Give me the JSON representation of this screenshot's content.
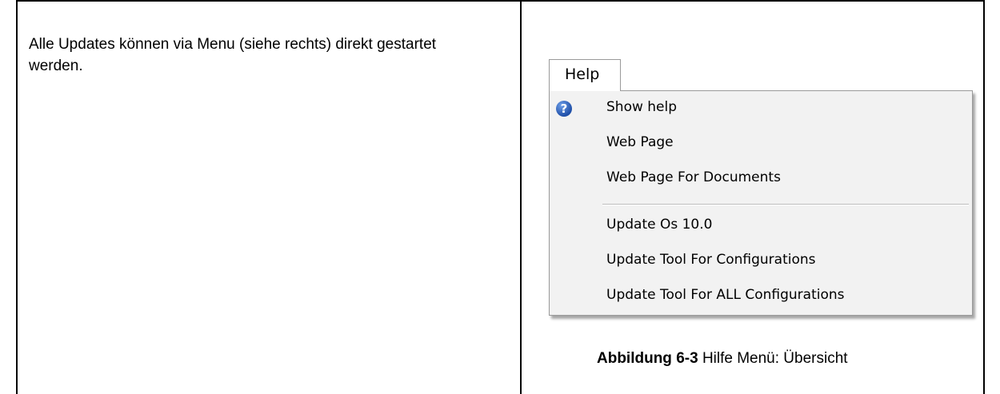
{
  "left_text": "Alle Updates können via Menu (siehe rechts) direkt gestartet werden.",
  "menu": {
    "header": "Help",
    "items_group1": [
      {
        "label": "Show help",
        "icon": "help-question-icon"
      },
      {
        "label": "Web Page"
      },
      {
        "label": "Web Page For Documents"
      }
    ],
    "items_group2": [
      {
        "label": "Update Os 10.0"
      },
      {
        "label": "Update Tool For Configurations"
      },
      {
        "label": "Update Tool For ALL Configurations"
      }
    ],
    "icon_glyph": "?"
  },
  "caption": {
    "label": "Abbildung 6-3",
    "text": "Hilfe Menü: Übersicht"
  },
  "colors": {
    "menu_background": "#f2f2f2",
    "menu_border": "#9a9a9a",
    "help_icon": "#1f4fa8"
  }
}
